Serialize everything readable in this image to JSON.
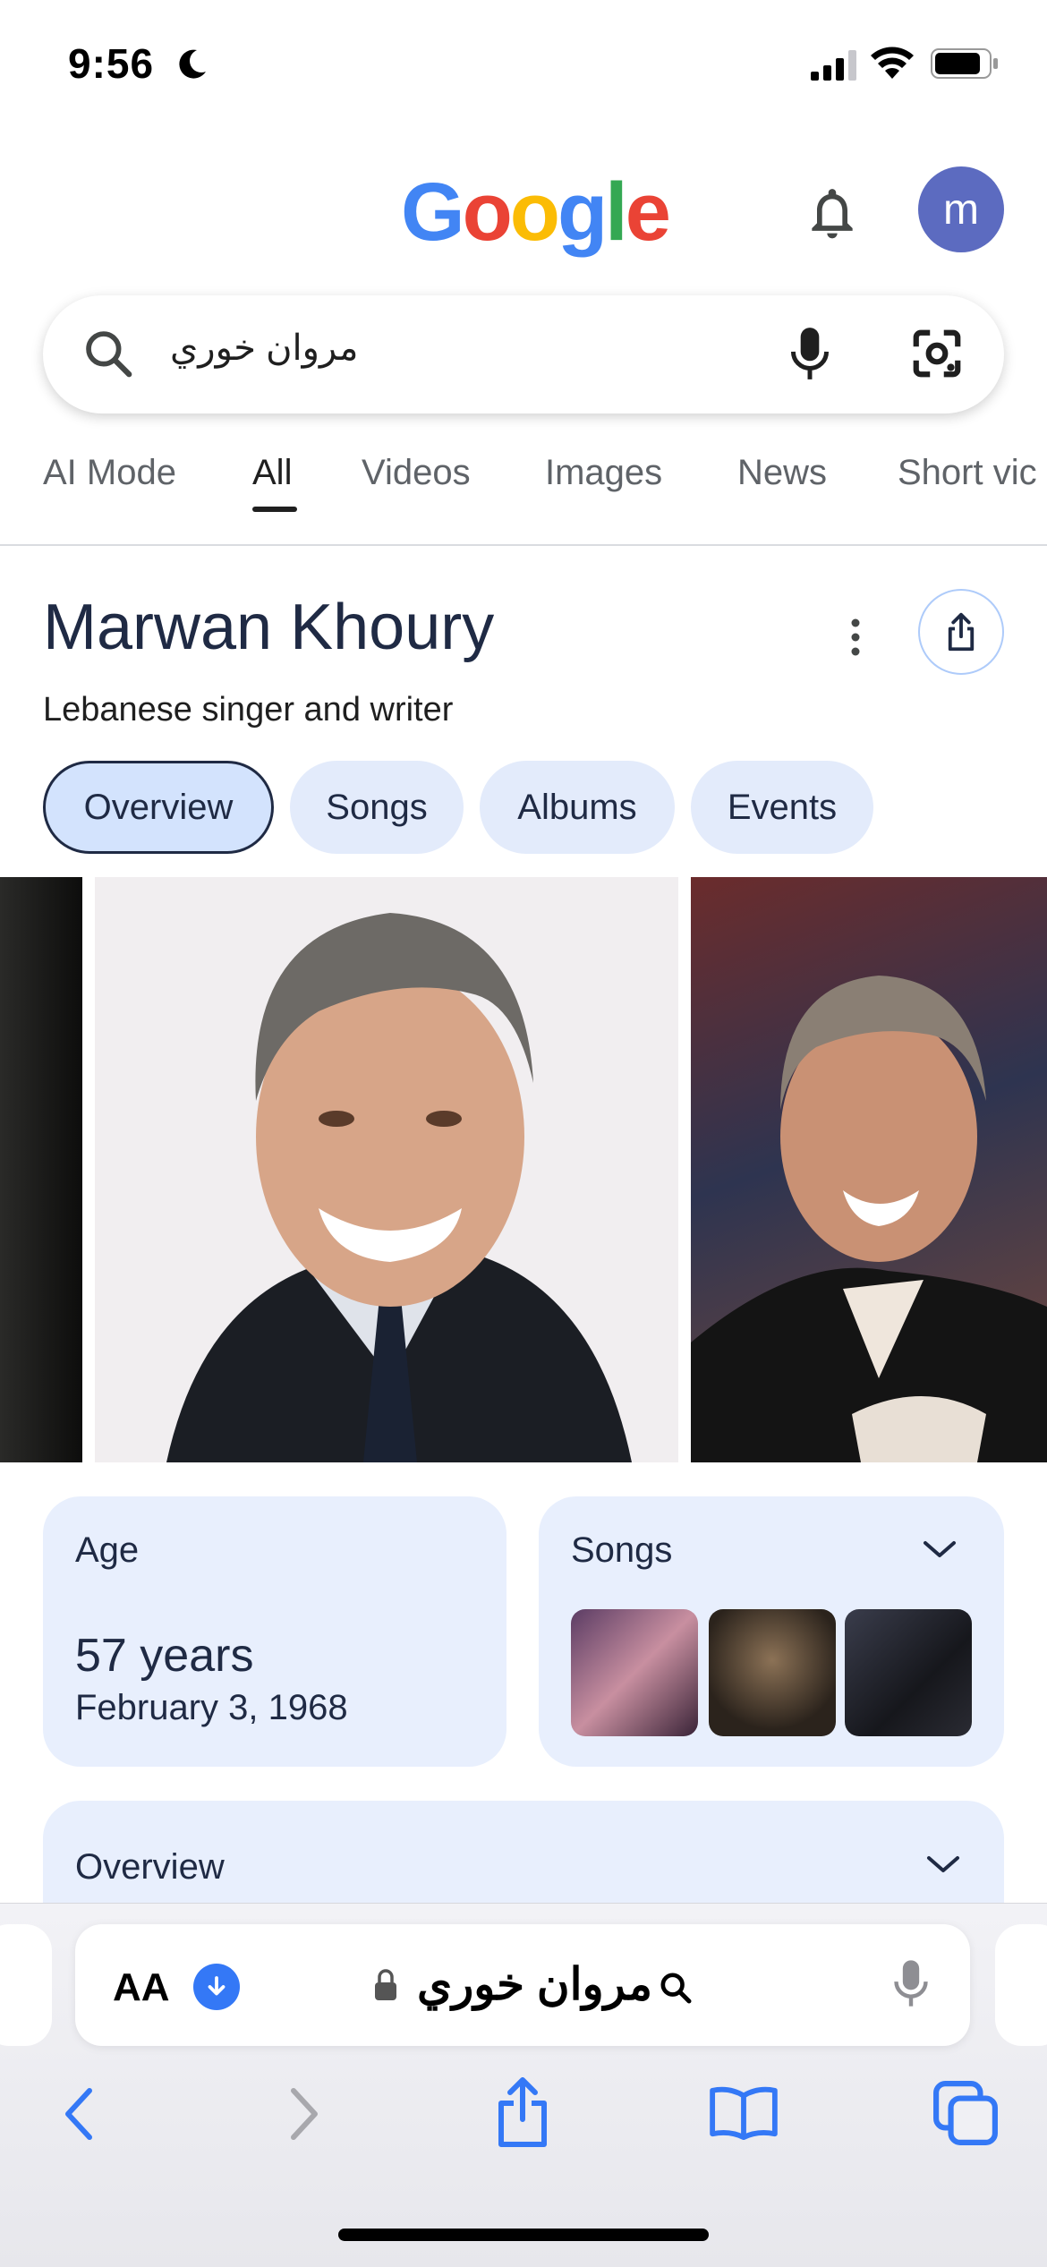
{
  "status_bar": {
    "time": "9:56"
  },
  "header": {
    "logo": "Google",
    "avatar_letter": "m"
  },
  "search": {
    "query": "مروان خوري"
  },
  "tabs": [
    {
      "label": "AI Mode"
    },
    {
      "label": "All"
    },
    {
      "label": "Videos"
    },
    {
      "label": "Images"
    },
    {
      "label": "News"
    },
    {
      "label": "Short vic"
    }
  ],
  "entity": {
    "title": "Marwan Khoury",
    "subtitle": "Lebanese singer and writer",
    "chips": [
      {
        "label": "Overview"
      },
      {
        "label": "Songs"
      },
      {
        "label": "Albums"
      },
      {
        "label": "Events"
      }
    ]
  },
  "cards": {
    "age": {
      "label": "Age",
      "value": "57 years",
      "date": "February 3, 1968"
    },
    "songs": {
      "label": "Songs"
    },
    "overview": {
      "label": "Overview"
    }
  },
  "browser": {
    "aa_label": "AA",
    "url": "مروان خوري"
  },
  "colors": {
    "google_blue": "#4285F4",
    "google_red": "#EA4335",
    "google_yellow": "#FBBC05",
    "google_green": "#34A853",
    "chip_bg": "#e3ebfb",
    "card_bg": "#e8effd",
    "safari_blue": "#3478f6"
  },
  "icons": [
    "moon-icon",
    "signal-icon",
    "wifi-icon",
    "battery-icon",
    "bell-icon",
    "search-icon",
    "mic-icon",
    "lens-icon",
    "more-vert-icon",
    "share-icon",
    "chevron-down-icon",
    "lock-icon",
    "back-icon",
    "forward-icon",
    "bookmarks-icon",
    "tabs-icon",
    "download-icon"
  ]
}
